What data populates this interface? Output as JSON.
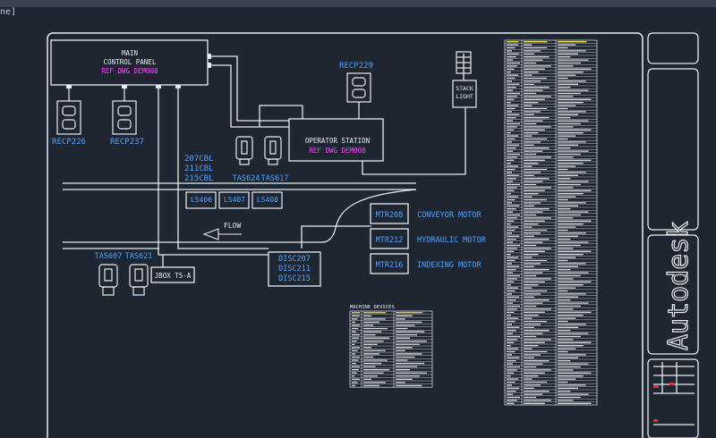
{
  "ui": {
    "tab_stub": "ne]"
  },
  "drawing": {
    "main_panel": {
      "line1": "MAIN",
      "line2": "CONTROL PANEL",
      "ref": "REF DWG DEMO08"
    },
    "operator_station": {
      "label": "OPERATOR STATION",
      "ref": "REF DWG DEMO08"
    },
    "recp226": "RECP226",
    "recp237": "RECP237",
    "recp229": "RECP229",
    "stack_light": {
      "line1": "STACK",
      "line2": "LIGHT"
    },
    "cables": [
      "207CBL",
      "211CBL",
      "215CBL"
    ],
    "tas624": "TAS624",
    "tas617": "TAS617",
    "tas607": "TAS607",
    "tas621": "TAS621",
    "ls": [
      "LS406",
      "LS407",
      "LS408"
    ],
    "flow": "FLOW",
    "disc": [
      "DISC207",
      "DISC211",
      "DISC215"
    ],
    "jbox": "JBOX T5-A",
    "motors": [
      {
        "tag": "MTR208",
        "name": "CONVEYOR MOTOR"
      },
      {
        "tag": "MTR212",
        "name": "HYDRAULIC MOTOR"
      },
      {
        "tag": "MTR216",
        "name": "INDEXING MOTOR"
      }
    ],
    "machine_devices_title": "MACHINE DEVICES",
    "autodesk_logo": "Autodesk"
  }
}
